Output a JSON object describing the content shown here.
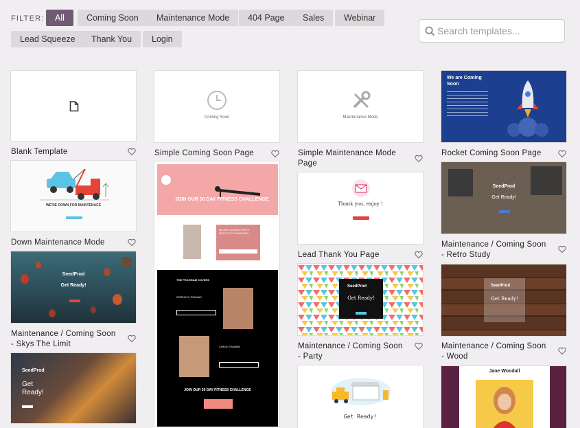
{
  "filter": {
    "label": "FILTER:",
    "buttons": [
      "All",
      "Coming Soon",
      "Maintenance Mode",
      "404 Page",
      "Sales",
      "Webinar",
      "Lead Squeeze",
      "Thank You",
      "Login"
    ],
    "active": "All"
  },
  "search": {
    "placeholder": "Search templates..."
  },
  "templates": {
    "blank": {
      "title": "Blank Template"
    },
    "simple_coming_soon": {
      "title": "Simple Coming Soon Page",
      "thumb_text": "Coming Soon"
    },
    "simple_maintenance": {
      "title": "Simple Maintenance Mode Page",
      "thumb_text": "Maintenance Mode"
    },
    "rocket": {
      "title": "Rocket Coming Soon Page",
      "headline": "We are Coming Soon"
    },
    "down_maintenance": {
      "title": "Down Maintenance Mode",
      "headline": "WE'RE DOWN FOR MAINTENACE"
    },
    "fitness": {
      "title": "",
      "headline": "JOIN OUR 30 DAY FITNESS CHALLENGE",
      "sub": "WE ARE LOOKING FOR 10 PEOPLE TO TRANSFORM",
      "covers": "THE PROGRAM COVERS",
      "strength": "STRENGTH TRAINING",
      "cardio": "CARDIO TRAINING",
      "bottom": "JOIN OUR 30 DAY FITNESS CHALLENGE"
    },
    "lead_thank_you": {
      "title": "Lead Thank You Page",
      "headline": "Thank you, enjoy !"
    },
    "retro_study": {
      "title": "Maintenance / Coming Soon - Retro Study",
      "brand": "SeedProd",
      "headline": "Get Ready!"
    },
    "skys_limit": {
      "title": "Maintenance / Coming Soon - Skys The Limit",
      "brand": "SeedProd",
      "headline": "Get Ready!"
    },
    "party": {
      "title": "Maintenance / Coming Soon - Party",
      "brand": "SeedProd",
      "headline": "Get Ready!"
    },
    "wood": {
      "title": "Maintenance / Coming Soon - Wood",
      "brand": "SeedProd",
      "headline": "Get Ready!"
    },
    "seedprod_dark": {
      "brand": "SeedProd",
      "headline": "Get Ready!"
    },
    "truck": {
      "headline": "Get Ready!"
    },
    "jane": {
      "name": "Jane Woodall"
    }
  },
  "colors": {
    "accent": "#705c72",
    "filter_bg": "#dcd8dc",
    "page_bg": "#f1eef1"
  }
}
